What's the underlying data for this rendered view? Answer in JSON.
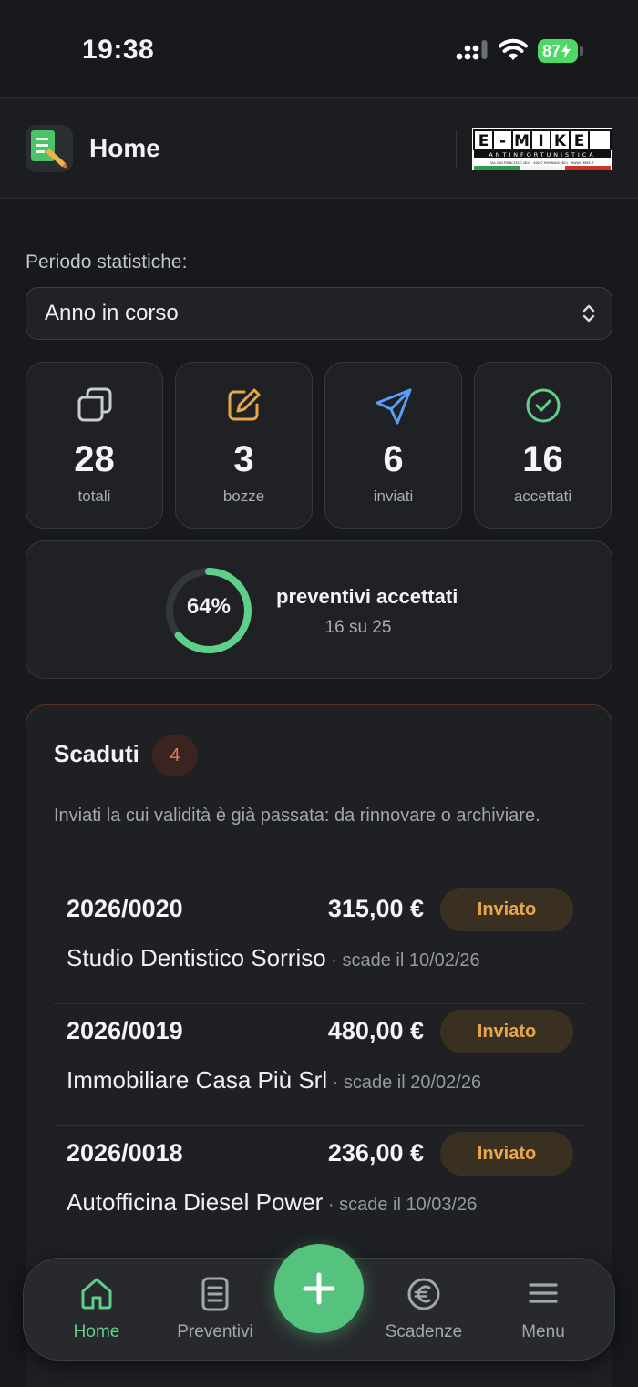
{
  "status_bar": {
    "time": "19:38",
    "battery": "87"
  },
  "header": {
    "title": "Home",
    "brand_name": "E-MIKE",
    "brand_tagline": "ANTINFORTUNISTICA",
    "brand_address": "VIA SAN FRANCESCO 2615 · 40027 MORDANO (BO) · WWW.E-MIKE.IT"
  },
  "period": {
    "label": "Periodo statistiche:",
    "selected": "Anno in corso"
  },
  "stats": [
    {
      "value": "28",
      "label": "totali",
      "icon": "copy-icon",
      "color": "#c9ccd1"
    },
    {
      "value": "3",
      "label": "bozze",
      "icon": "edit-icon",
      "color": "#e8a64a"
    },
    {
      "value": "6",
      "label": "inviati",
      "icon": "send-icon",
      "color": "#5b9cf5"
    },
    {
      "value": "16",
      "label": "accettati",
      "icon": "check-circle-icon",
      "color": "#5fd08a"
    }
  ],
  "acceptance": {
    "percent_label": "64%",
    "percent": 64,
    "title": "preventivi accettati",
    "subtitle": "16 su 25"
  },
  "expired": {
    "title": "Scaduti",
    "count": "4",
    "description": "Inviati la cui validità è già passata: da rinnovare o archiviare.",
    "items": [
      {
        "number": "2026/0020",
        "amount": "315,00 €",
        "status": "Inviato",
        "client": "Studio Dentistico Sorriso",
        "due": " · scade il 10/02/26"
      },
      {
        "number": "2026/0019",
        "amount": "480,00 €",
        "status": "Inviato",
        "client": "Immobiliare Casa Più Srl",
        "due": " · scade il 20/02/26"
      },
      {
        "number": "2026/0018",
        "amount": "236,00 €",
        "status": "Inviato",
        "client": "Autofficina Diesel Power",
        "due": " · scade il 10/03/26"
      }
    ]
  },
  "nav": {
    "items": [
      {
        "label": "Home",
        "icon": "home-icon",
        "active": true
      },
      {
        "label": "Preventivi",
        "icon": "document-icon",
        "active": false
      },
      {
        "label": "Scadenze",
        "icon": "euro-icon",
        "active": false
      },
      {
        "label": "Menu",
        "icon": "menu-icon",
        "active": false
      }
    ],
    "fab_icon": "plus-icon"
  },
  "colors": {
    "accent_green": "#55c27d",
    "warning": "#e8a64a",
    "danger": "#e07a5f",
    "background": "#17191c"
  }
}
